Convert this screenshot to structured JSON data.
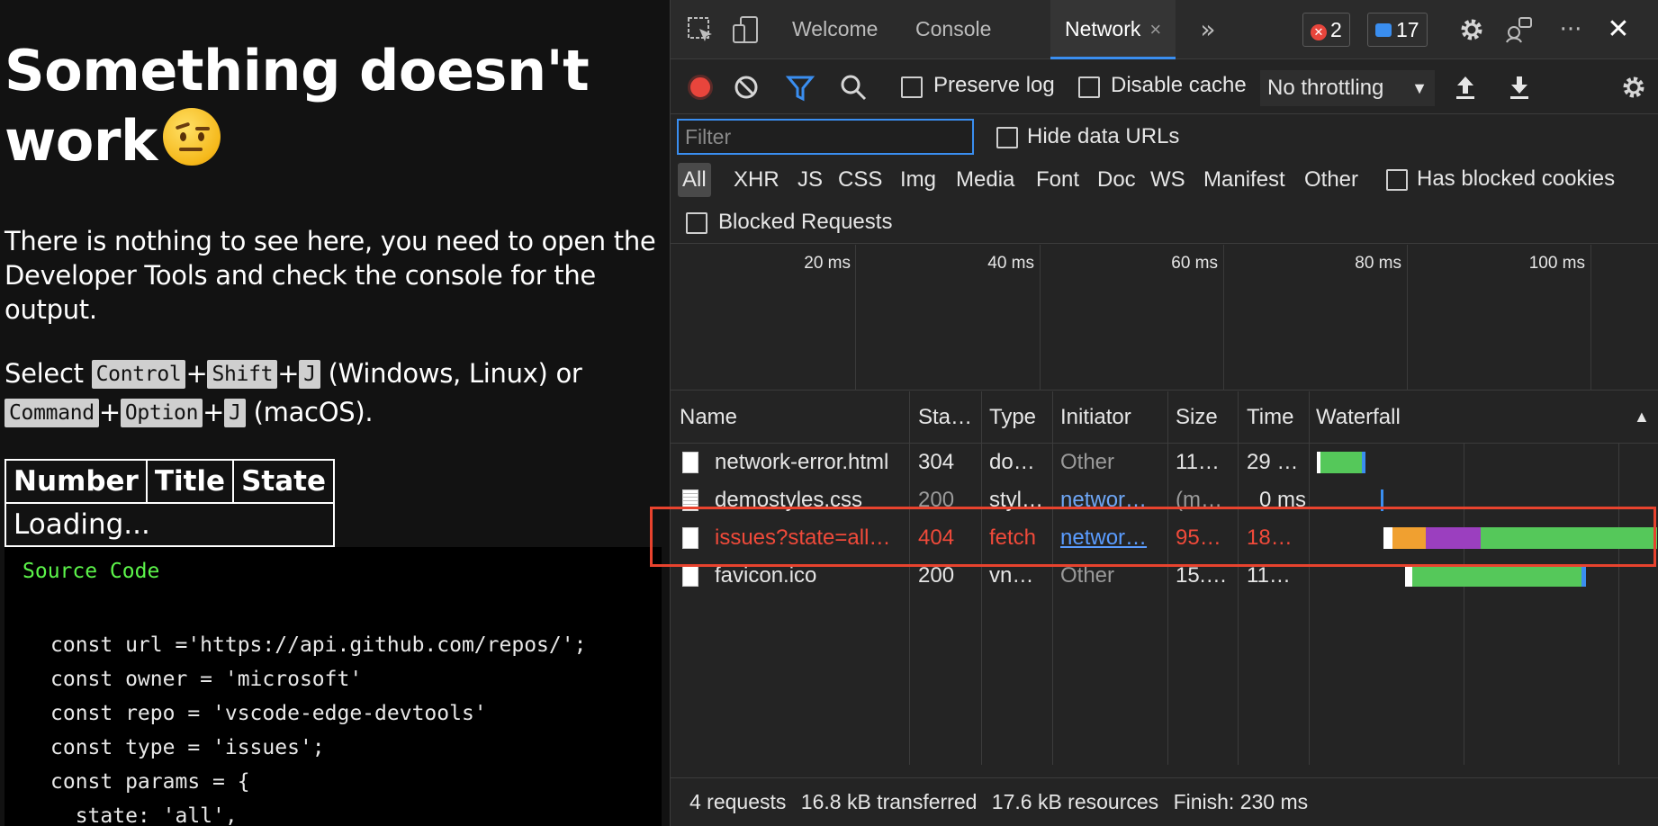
{
  "page": {
    "heading": "Something doesn't work",
    "intro": "There is nothing to see here, you need to open the Developer Tools and check the console for the output.",
    "shortcut": {
      "prefix": "Select",
      "win_keys": [
        "Control",
        "Shift",
        "J"
      ],
      "win_suffix": "(Windows, Linux) or",
      "mac_keys": [
        "Command",
        "Option",
        "J"
      ],
      "mac_suffix": "(macOS)."
    },
    "table": {
      "headers": [
        "Number",
        "Title",
        "State"
      ],
      "loading": "Loading..."
    },
    "code": {
      "title": "Source Code",
      "lines": [
        "const url ='https://api.github.com/repos/';",
        "const owner = 'microsoft'",
        "const repo = 'vscode-edge-devtools'",
        "const type = 'issues';",
        "const params = {",
        "  state: 'all',"
      ]
    }
  },
  "devtools": {
    "tabs": [
      {
        "label": "Welcome",
        "active": false
      },
      {
        "label": "Console",
        "active": false
      },
      {
        "label": "Network",
        "active": true
      }
    ],
    "close_glyph": "×",
    "more_tabs_glyph": "»",
    "error_count": "2",
    "message_count": "17",
    "toolbar": {
      "preserve_log": "Preserve log",
      "disable_cache": "Disable cache",
      "throttling": "No throttling"
    },
    "filter": {
      "placeholder": "Filter",
      "hide_data_urls": "Hide data URLs",
      "types": [
        "All",
        "XHR",
        "JS",
        "CSS",
        "Img",
        "Media",
        "Font",
        "Doc",
        "WS",
        "Manifest",
        "Other"
      ],
      "active_type": "All",
      "has_blocked_cookies": "Has blocked cookies",
      "blocked_requests": "Blocked Requests"
    },
    "overview_ticks": [
      "20 ms",
      "40 ms",
      "60 ms",
      "80 ms",
      "100 ms"
    ],
    "columns": [
      "Name",
      "Sta…",
      "Type",
      "Initiator",
      "Size",
      "Time",
      "Waterfall"
    ],
    "sort_glyph": "▲",
    "rows": [
      {
        "name": "network-error.html",
        "status": "304",
        "type": "do…",
        "initiator": "Other",
        "size": "11…",
        "time": "29 …",
        "error": false
      },
      {
        "name": "demostyles.css",
        "status": "200",
        "type": "styl…",
        "initiator": "networ…",
        "size": "(m…",
        "time": "0 ms",
        "error": false
      },
      {
        "name": "issues?state=all…",
        "status": "404",
        "type": "fetch",
        "initiator": "networ…",
        "size": "95…",
        "time": "18…",
        "error": true
      },
      {
        "name": "favicon.ico",
        "status": "200",
        "type": "vn…",
        "initiator": "Other",
        "size": "15.…",
        "time": "11…",
        "error": false
      }
    ],
    "status": {
      "requests": "4 requests",
      "transferred": "16.8 kB transferred",
      "resources": "17.6 kB resources",
      "finish": "Finish: 230 ms"
    },
    "colors": {
      "accent": "#3a8ef0",
      "error": "#f04a3a",
      "waterfall_green": "#55c85a",
      "waterfall_orange": "#f0a030",
      "waterfall_purple": "#9b3fbf",
      "highlight": "#e8432e"
    },
    "icons": [
      "inspect-icon",
      "device-icon",
      "gear-icon",
      "feedback-icon",
      "more-icon",
      "close-icon",
      "record-icon",
      "clear-icon",
      "filter-icon",
      "search-icon",
      "upload-icon",
      "download-icon"
    ]
  }
}
